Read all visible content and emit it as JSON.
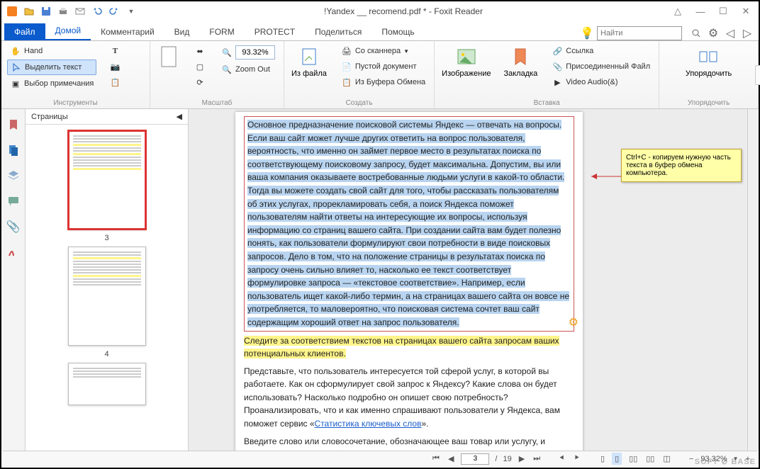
{
  "window": {
    "title": "!Yandex __ recomend.pdf * - Foxit Reader"
  },
  "tabs": {
    "file": "Файл",
    "items": [
      "Домой",
      "Комментарий",
      "Вид",
      "FORM",
      "PROTECT",
      "Поделиться",
      "Помощь"
    ],
    "active": 0,
    "search_placeholder": "Найти"
  },
  "ribbon": {
    "groups": [
      {
        "label": "Инструменты",
        "col1": [
          {
            "icon": "hand",
            "text": "Hand"
          },
          {
            "icon": "cursor",
            "text": "Выделить текст",
            "active": true
          },
          {
            "icon": "select-note",
            "text": "Выбор примечания"
          }
        ],
        "col2": [
          {
            "icon": "text-tool"
          },
          {
            "icon": "camera"
          },
          {
            "icon": "clipboard"
          }
        ]
      },
      {
        "label": "Масштаб",
        "big": {
          "icon": "fit",
          "text": ""
        },
        "zoom_icons": [
          "fit-width",
          "fit-page",
          "rotate"
        ],
        "zoom_value": "93.32%",
        "zoom_out": "Zoom Out"
      },
      {
        "label": "Создать",
        "big": {
          "icon": "from-file",
          "text": "Из файла"
        },
        "items": [
          {
            "icon": "scanner",
            "text": "Со сканнера"
          },
          {
            "icon": "blank",
            "text": "Пустой документ"
          },
          {
            "icon": "clipboard",
            "text": "Из Буфера Обмена"
          }
        ]
      },
      {
        "label": "Вставка",
        "big1": {
          "icon": "image",
          "text": "Изображение"
        },
        "big2": {
          "icon": "bookmark",
          "text": "Закладка"
        },
        "items": [
          {
            "icon": "link",
            "text": "Ссылка"
          },
          {
            "icon": "attach",
            "text": "Присоединенный Файл"
          },
          {
            "icon": "video",
            "text": "Video  Audio(&)"
          }
        ]
      },
      {
        "label": "Упорядочить",
        "big": {
          "icon": "organize",
          "text": "Упорядочить"
        }
      }
    ]
  },
  "sidebar": {
    "panel_title": "Страницы",
    "thumbs": [
      {
        "n": "3",
        "sel": true
      },
      {
        "n": "4"
      },
      {
        "n": ""
      }
    ]
  },
  "document": {
    "selected_text": "Основное предназначение поисковой системы Яндекс — отвечать на вопросы. Если ваш сайт может лучше других ответить на вопрос пользователя, вероятность, что именно он займет первое место в результатах поиска по соответствующему поисковому запросу, будет максимальна. Допустим, вы или ваша компания оказываете востребованные людьми услуги в какой-то области. Тогда вы можете создать свой сайт для того, чтобы рассказать пользователям об этих услугах, прорекламировать себя, а поиск Яндекса поможет пользователям найти ответы на интересующие их вопросы, используя информацию со страниц вашего сайта. При создании сайта вам будет полезно понять, как пользователи формулируют свои потребности в виде поисковых запросов. Дело в том, что на положение страницы в результатах поиска по запросу очень сильно влияет то, насколько ее текст соответствует формулировке запроса — «текстовое соответствие». Например, если пользователь ищет какой-либо термин, а на страницах вашего сайта он вовсе не употребляется, то маловероятно, что поисковая система сочтет ваш сайт содержащим хороший ответ на запрос пользователя.",
    "yellow_text": "Следите за соответствием текстов на страницах вашего сайта запросам ваших потенциальных клиентов.",
    "para2": "Представьте, что пользователь интересуется той сферой услуг, в которой вы работаете. Как он сформулирует свой запрос к Яндексу? Какие слова он будет использовать? Насколько подробно он опишет свою потребность? Проанализировать, что и как именно спрашивают пользователи у Яндекса, вам поможет сервис «",
    "link_text": "Статистика ключевых слов",
    "para2_end": "».",
    "para3": "Введите слово или словосочетание, обозначающее ваш товар или услугу, и нажмите кнопку «Подобрать». Вы увидите запросы пользователей, включающие заданные вами слово или словосочетание (слева), и свя-"
  },
  "tooltip": "Ctrl+C - копируем нужную часть текста в буфер обмена компьютера.",
  "status": {
    "page_current": "3",
    "page_total": "19",
    "zoom": "93.32%"
  },
  "watermark": "SOFT ⊘ BASE"
}
